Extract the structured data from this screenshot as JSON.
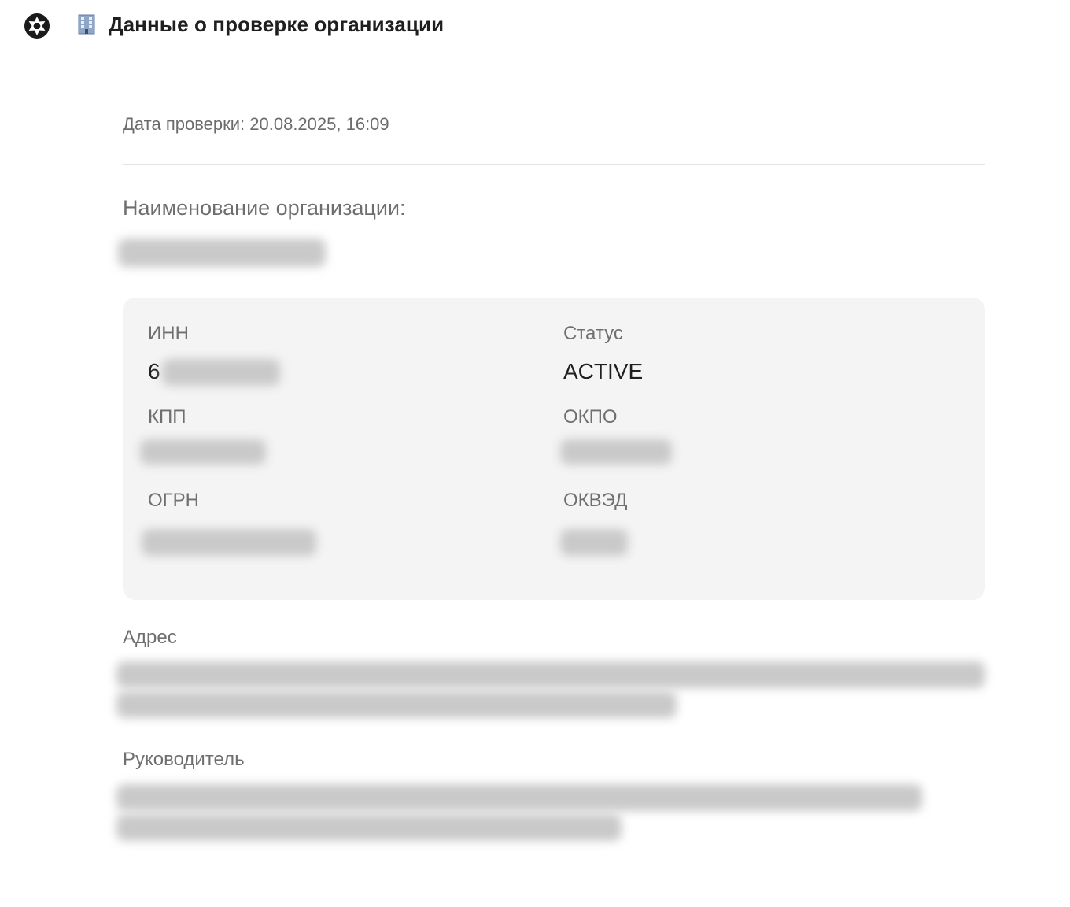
{
  "header": {
    "app_icon": "aperture-icon",
    "building_icon": "office-building-icon",
    "title": "Данные о проверке организации"
  },
  "check": {
    "date_label": "Дата проверки: 20.08.2025, 16:09"
  },
  "organization": {
    "name_label": "Наименование организации:",
    "name_value": ""
  },
  "card": {
    "inn": {
      "label": "ИНН",
      "visible_prefix": "6",
      "value": ""
    },
    "status": {
      "label": "Статус",
      "value": "ACTIVE"
    },
    "kpp": {
      "label": "КПП",
      "value": ""
    },
    "okpo": {
      "label": "ОКПО",
      "value": ""
    },
    "ogrn": {
      "label": "ОГРН",
      "value": ""
    },
    "okved": {
      "label": "ОКВЭД",
      "value": ""
    }
  },
  "address": {
    "label": "Адрес",
    "value": ""
  },
  "director": {
    "label": "Руководитель",
    "value": ""
  }
}
